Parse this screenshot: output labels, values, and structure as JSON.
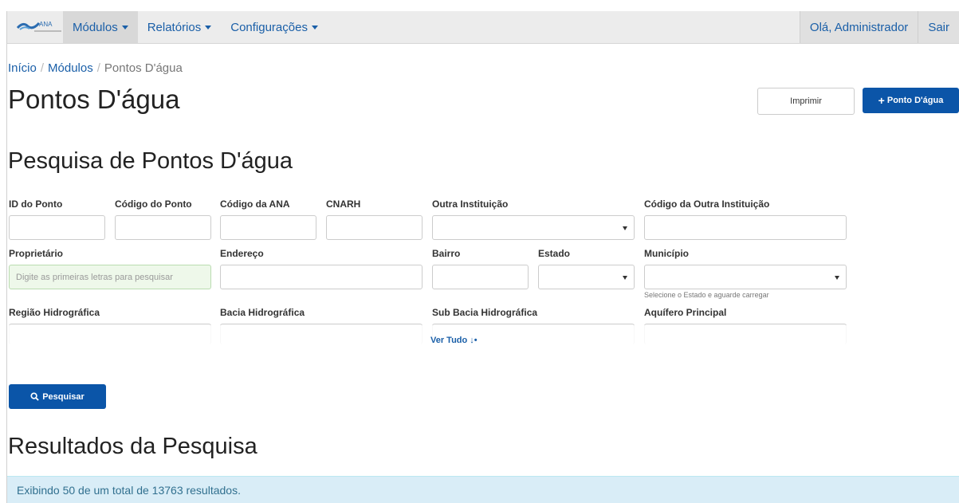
{
  "navbar": {
    "logo_text": "ANA",
    "items": [
      {
        "label": "Módulos",
        "active": true
      },
      {
        "label": "Relatórios",
        "active": false
      },
      {
        "label": "Configurações",
        "active": false
      }
    ],
    "user_greeting": "Olá, Administrador",
    "logout": "Sair"
  },
  "breadcrumb": [
    "Início",
    "Módulos",
    "Pontos D'água"
  ],
  "page_title": "Pontos D'água",
  "actions": {
    "print": "Imprimir",
    "add": "Ponto D'água"
  },
  "search": {
    "title": "Pesquisa de Pontos D'água",
    "fields": {
      "id_ponto": "ID do Ponto",
      "codigo_ponto": "Código do Ponto",
      "codigo_ana": "Código da ANA",
      "cnarh": "CNARH",
      "outra_instituicao": "Outra Instituição",
      "codigo_outra_instituicao": "Código da Outra Instituição",
      "proprietario": "Proprietário",
      "proprietario_placeholder": "Digite as primeiras letras para pesquisar",
      "endereco": "Endereço",
      "bairro": "Bairro",
      "estado": "Estado",
      "municipio": "Município",
      "municipio_help": "Selecione o Estado e aguarde carregar",
      "regiao_hidrografica": "Região Hidrográfica",
      "bacia_hidrografica": "Bacia Hidrográfica",
      "sub_bacia_hidrografica": "Sub Bacia Hidrográfica",
      "aquifero_principal": "Aquífero Principal"
    },
    "ver_tudo": "Ver Tudo ↓•",
    "search_button": "Pesquisar"
  },
  "results": {
    "title": "Resultados da Pesquisa",
    "summary": "Exibindo 50 de um total de 13763 resultados."
  },
  "colors": {
    "primary": "#0b55a8",
    "link": "#1a5fa8",
    "info_bg": "#d9edf7"
  }
}
